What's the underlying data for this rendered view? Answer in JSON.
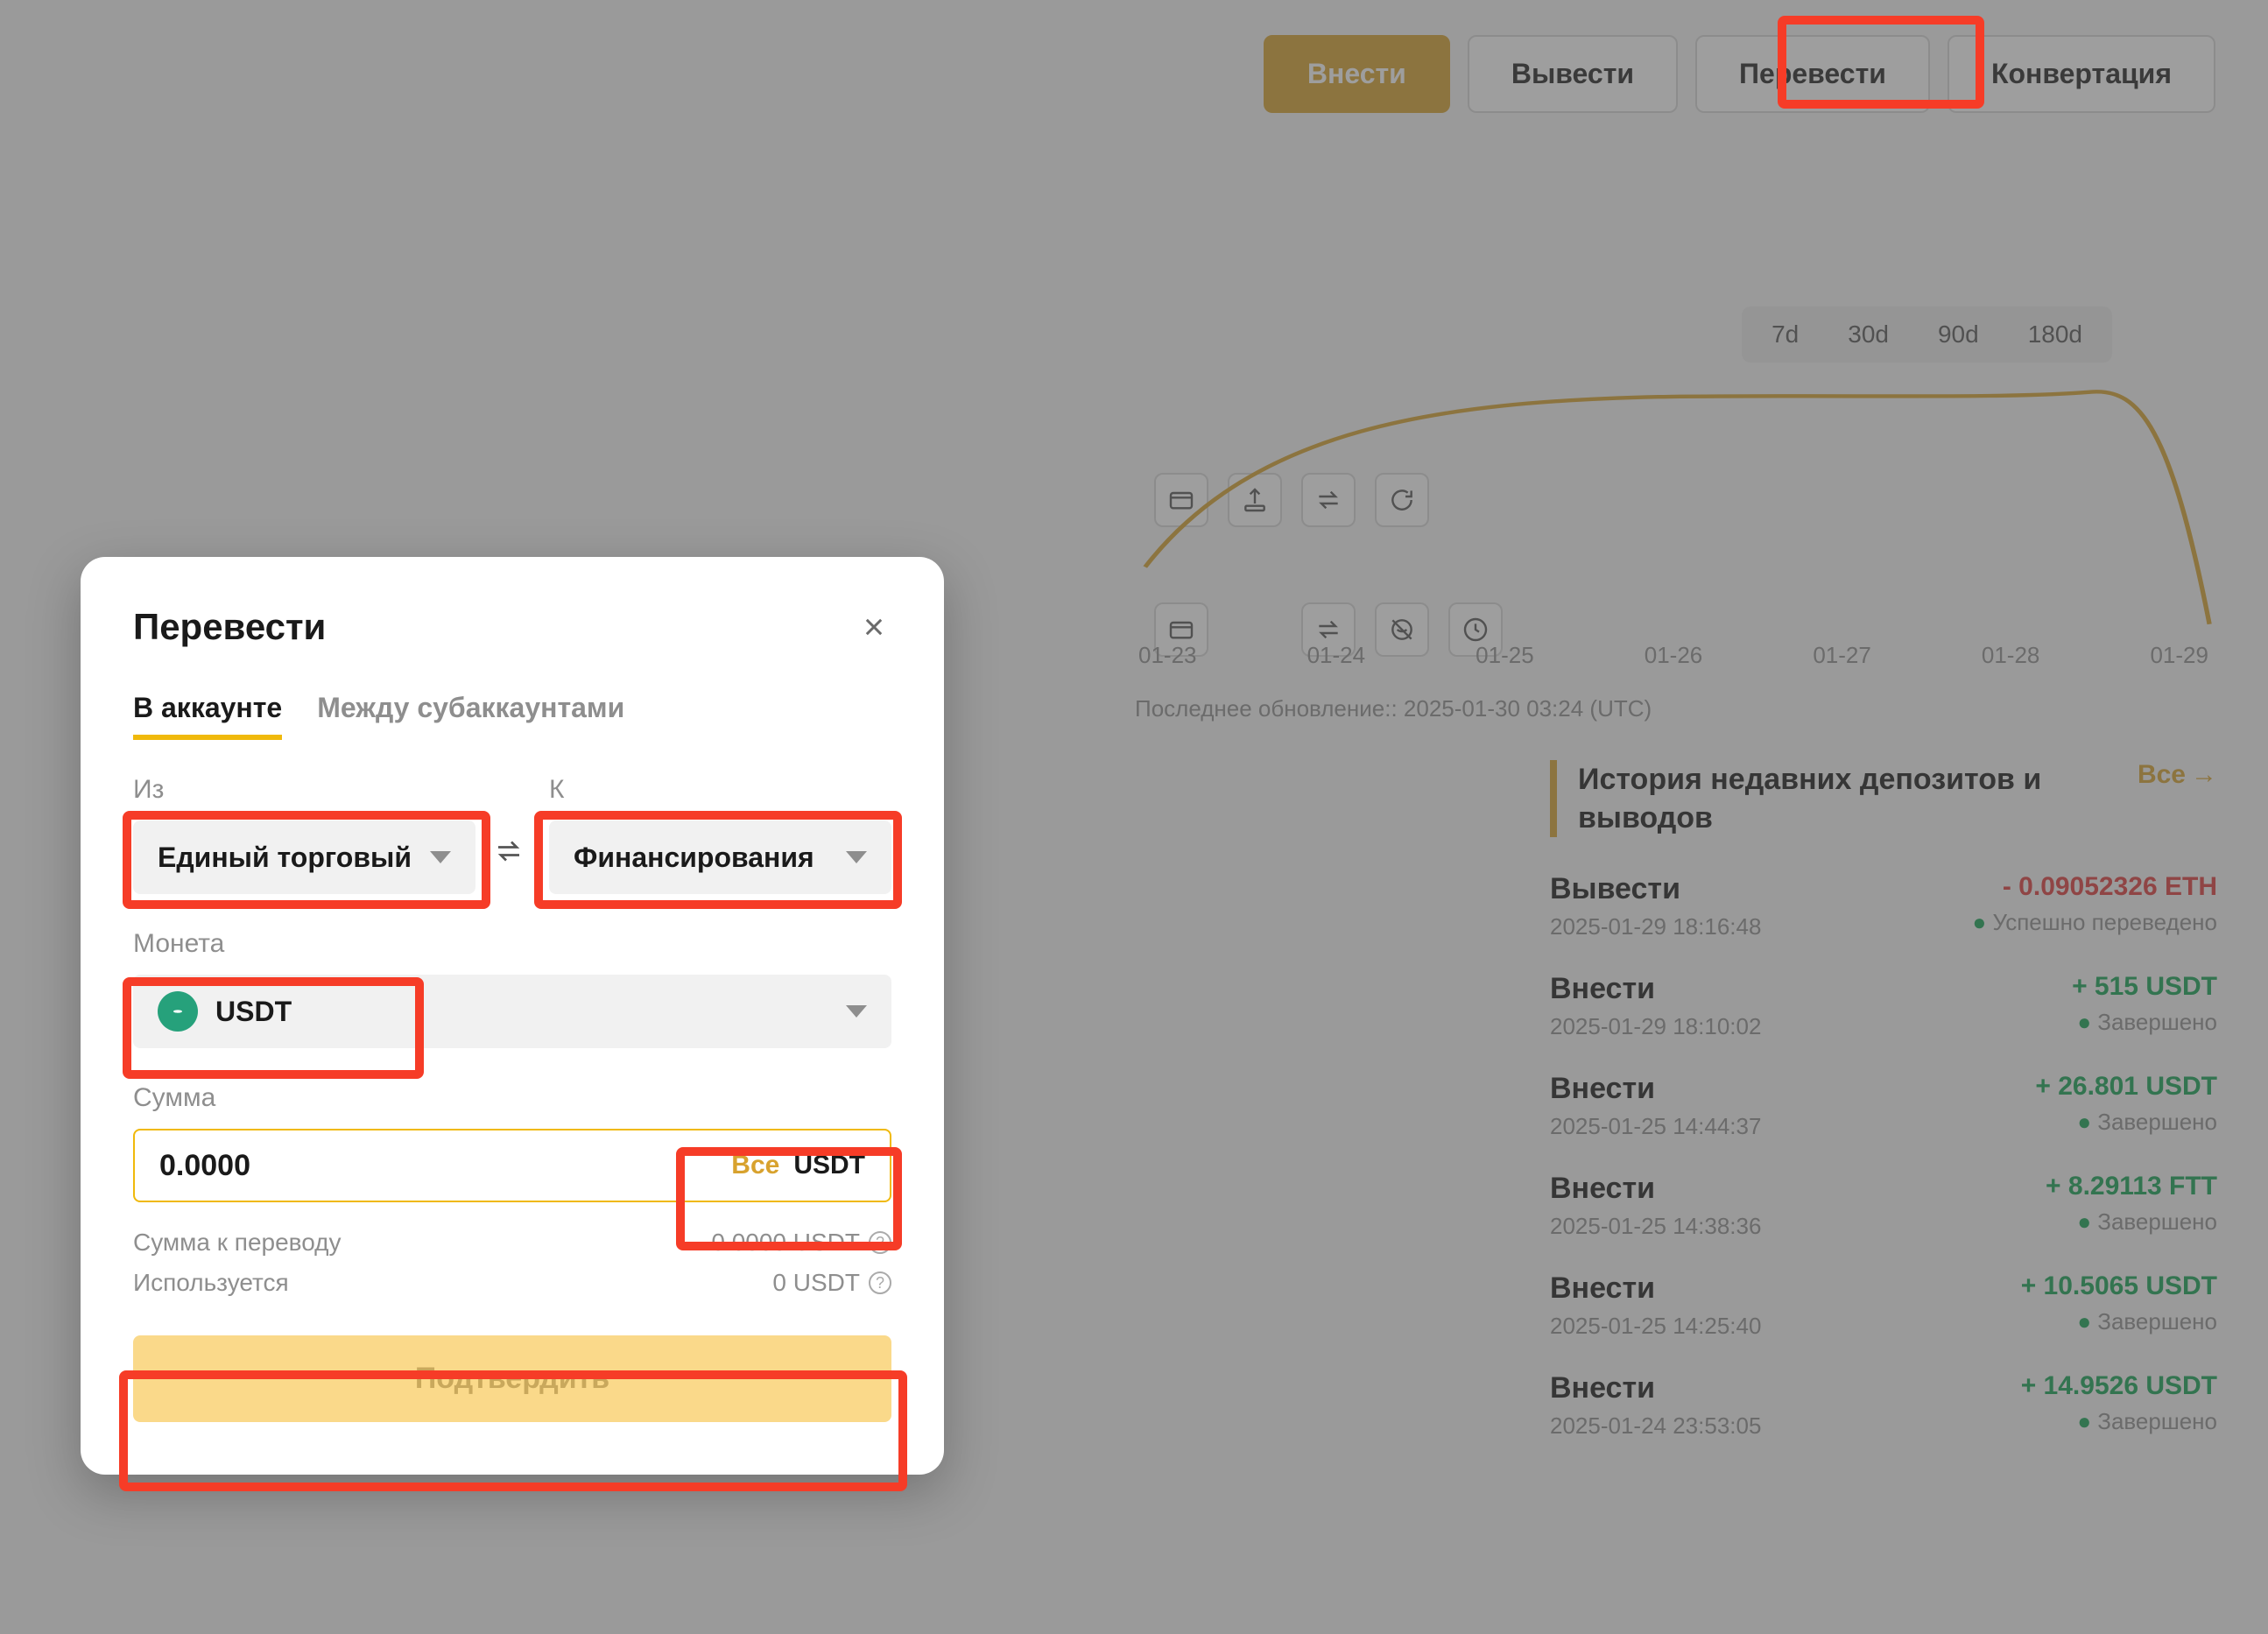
{
  "topActions": {
    "deposit": "Внести",
    "withdraw": "Вывести",
    "transfer": "Перевести",
    "convert": "Конвертация"
  },
  "iconNames": {
    "wallet": "wallet",
    "upload": "upload",
    "swap": "swap",
    "refresh": "refresh",
    "hideBalance": "hide-balance",
    "clock": "clock"
  },
  "chart": {
    "ranges": [
      "7d",
      "30d",
      "90d",
      "180d"
    ],
    "axisDates": [
      "01-23",
      "01-24",
      "01-25",
      "01-26",
      "01-27",
      "01-28",
      "01-29"
    ],
    "lastUpdate": "Последнее обновление:: 2025-01-30 03:24 (UTC)"
  },
  "history": {
    "title": "История недавних депозитов и выводов",
    "allLabel": "Все",
    "items": [
      {
        "type": "Вывести",
        "time": "2025-01-29 18:16:48",
        "amount": "- 0.09052326 ETH",
        "positive": false,
        "status": "Успешно переведено"
      },
      {
        "type": "Внести",
        "time": "2025-01-29 18:10:02",
        "amount": "+ 515 USDT",
        "positive": true,
        "status": "Завершено"
      },
      {
        "type": "Внести",
        "time": "2025-01-25 14:44:37",
        "amount": "+ 26.801 USDT",
        "positive": true,
        "status": "Завершено"
      },
      {
        "type": "Внести",
        "time": "2025-01-25 14:38:36",
        "amount": "+ 8.29113 FTT",
        "positive": true,
        "status": "Завершено"
      },
      {
        "type": "Внести",
        "time": "2025-01-25 14:25:40",
        "amount": "+ 10.5065 USDT",
        "positive": true,
        "status": "Завершено"
      },
      {
        "type": "Внести",
        "time": "2025-01-24 23:53:05",
        "amount": "+ 14.9526 USDT",
        "positive": true,
        "status": "Завершено"
      }
    ]
  },
  "modal": {
    "title": "Перевести",
    "tabs": {
      "inAccount": "В аккаунте",
      "subAccounts": "Между субаккаунтами"
    },
    "fromLabel": "Из",
    "toLabel": "К",
    "fromValue": "Единый торговый",
    "toValue": "Финансирования",
    "coinLabel": "Монета",
    "coinValue": "USDT",
    "amountLabel": "Сумма",
    "amountValue": "0.0000",
    "allLabel": "Все",
    "amountUnit": "USDT",
    "transferableLabel": "Сумма к переводу",
    "transferableValue": "0.0000 USDT",
    "usedLabel": "Используется",
    "usedValue": "0 USDT",
    "confirm": "Подтвердить"
  }
}
